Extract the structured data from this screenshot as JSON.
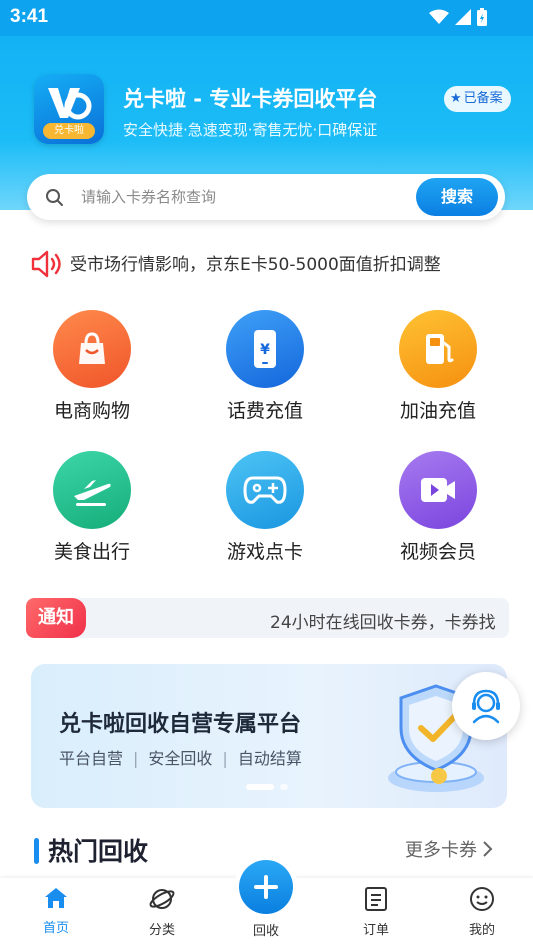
{
  "status_bar": {
    "time": "3:41"
  },
  "header": {
    "app_title": "兑卡啦 - 专业卡券回收平台",
    "app_subtitle": "安全快捷·急速变现·寄售无忧·口碑保证",
    "logo_badge": "兑卡啦",
    "filed_badge": "已备案"
  },
  "search": {
    "placeholder": "请输入卡券名称查询",
    "button_label": "搜索"
  },
  "marquee": {
    "text": "受市场行情影响，京东E卡50-5000面值折扣调整"
  },
  "categories": [
    {
      "label": "电商购物",
      "icon": "shopping-bag-icon",
      "color": "#f76b3c"
    },
    {
      "label": "话费充值",
      "icon": "phone-yuan-icon",
      "color": "#1f84ec"
    },
    {
      "label": "加油充值",
      "icon": "fuel-pump-icon",
      "color": "#f7a21b"
    },
    {
      "label": "美食出行",
      "icon": "airplane-icon",
      "color": "#1fbf8f"
    },
    {
      "label": "游戏点卡",
      "icon": "gamepad-icon",
      "color": "#22a6e6"
    },
    {
      "label": "视频会员",
      "icon": "video-icon",
      "color": "#8c5be6"
    }
  ],
  "notice": {
    "tag": "通知",
    "text": "24小时在线回收卡券，卡券找"
  },
  "banner": {
    "title": "兑卡啦回收自营专属平台",
    "tags": [
      "平台自营",
      "安全回收",
      "自动结算"
    ]
  },
  "hot_section": {
    "title": "热门回收",
    "more_label": "更多卡券"
  },
  "bottom_nav": {
    "home": "首页",
    "category": "分类",
    "recycle": "回收",
    "orders": "订单",
    "mine": "我的"
  },
  "colors": {
    "brand_blue": "#0ea3ef",
    "active_blue": "#1a8df0",
    "notice_red": "#f0304a"
  }
}
